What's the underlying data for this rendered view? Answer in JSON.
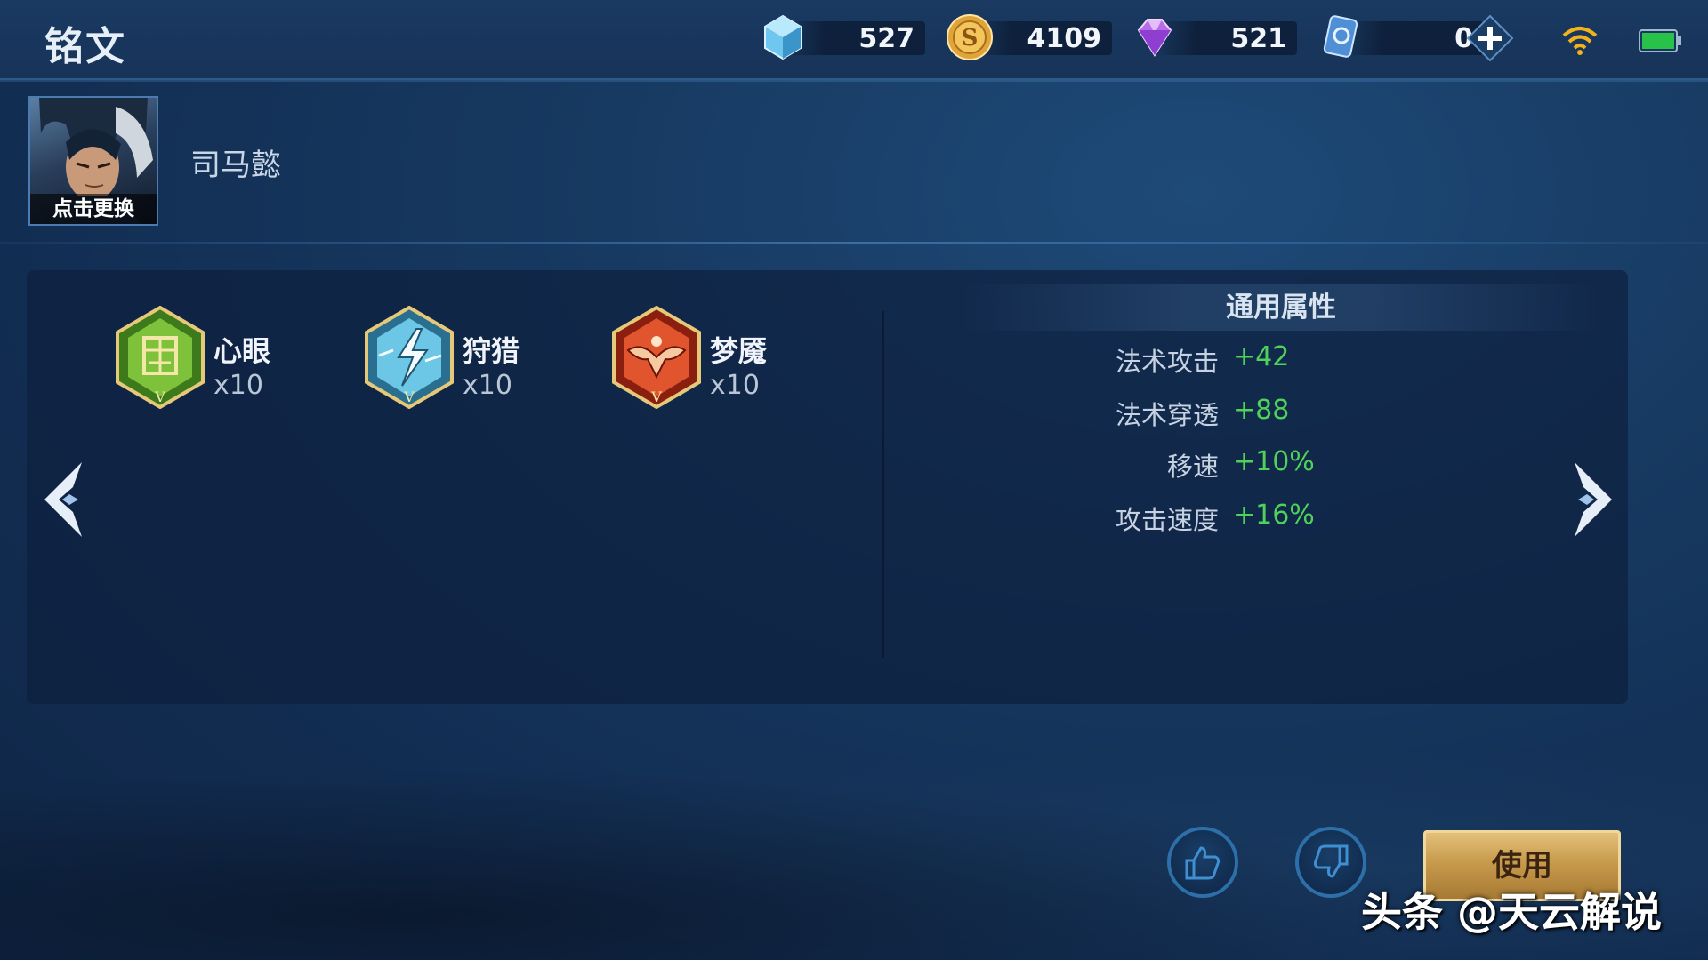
{
  "header": {
    "title": "铭文",
    "currencies": [
      {
        "icon": "crystal-icon",
        "value": "527"
      },
      {
        "icon": "gold-coin-icon",
        "value": "4109"
      },
      {
        "icon": "diamond-icon",
        "value": "521"
      },
      {
        "icon": "ticket-icon",
        "value": "0"
      }
    ],
    "add_icon": "plus-icon",
    "wifi_icon": "wifi-icon",
    "battery_icon": "battery-icon"
  },
  "hero": {
    "avatar_caption": "点击更换",
    "name": "司马懿"
  },
  "runes": [
    {
      "name": "心眼",
      "count": "x10",
      "icon": "rune-green-icon",
      "color": "#5aa02c"
    },
    {
      "name": "狩猎",
      "count": "x10",
      "icon": "rune-blue-icon",
      "color": "#3fa6c9"
    },
    {
      "name": "梦魇",
      "count": "x10",
      "icon": "rune-red-icon",
      "color": "#c8432a"
    }
  ],
  "attributes": {
    "title": "通用属性",
    "items": [
      {
        "label": "法术攻击",
        "value": "+42"
      },
      {
        "label": "法术穿透",
        "value": "+88"
      },
      {
        "label": "移速",
        "value": "+10%"
      },
      {
        "label": "攻击速度",
        "value": "+16%"
      }
    ]
  },
  "buttons": {
    "like_icon": "thumbs-up-icon",
    "dislike_icon": "thumbs-down-icon",
    "use_label": "使用"
  },
  "watermark": "头条 @天云解说",
  "colors": {
    "accent_green": "#4fd15a",
    "gold_button": "#c79a4c",
    "bg_dark": "#122d52"
  }
}
